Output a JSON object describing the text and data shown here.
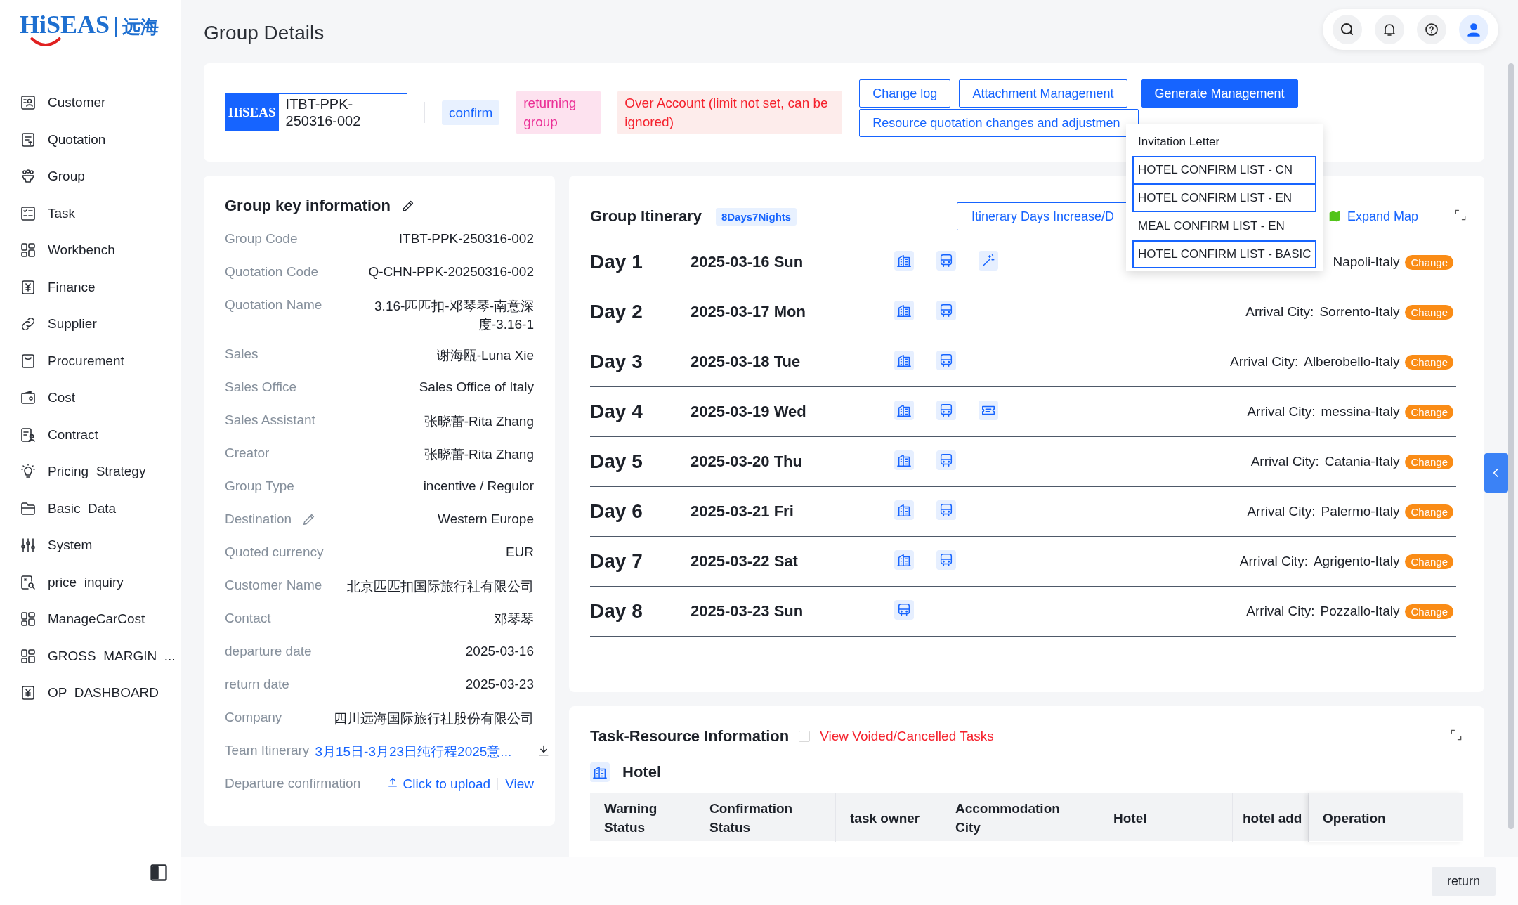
{
  "brand": {
    "logo": "HiSEAS",
    "logo_cn": "远海"
  },
  "sidebar": {
    "items": [
      {
        "label": "Customer"
      },
      {
        "label": "Quotation"
      },
      {
        "label": "Group"
      },
      {
        "label": "Task"
      },
      {
        "label": "Workbench"
      },
      {
        "label": "Finance"
      },
      {
        "label": "Supplier"
      },
      {
        "label": "Procurement"
      },
      {
        "label": "Cost"
      },
      {
        "label": "Contract"
      },
      {
        "label": "Pricing  Strategy"
      },
      {
        "label": "Basic  Data"
      },
      {
        "label": "System"
      },
      {
        "label": "price  inquiry"
      },
      {
        "label": "ManageCarCost"
      },
      {
        "label": "GROSS  MARGIN  ..."
      },
      {
        "label": "OP  DASHBOARD"
      }
    ]
  },
  "page_title": "Group Details",
  "group_header": {
    "badge": "HiSEAS",
    "code": "ITBT-PPK-250316-002",
    "tags": [
      {
        "kind": "info",
        "label": "confirm"
      },
      {
        "kind": "pink",
        "label": "returning group"
      },
      {
        "kind": "warning",
        "label": "Over Account (limit not set, can be ignored)"
      }
    ],
    "actions": [
      {
        "kind": "outline",
        "label": "Change log"
      },
      {
        "kind": "outline",
        "label": "Attachment Management"
      },
      {
        "kind": "primary",
        "label": "Generate Management"
      },
      {
        "kind": "outline",
        "label": "Resource quotation changes and adjustmen"
      }
    ]
  },
  "generate_menu": {
    "items": [
      {
        "label": "Invitation Letter",
        "outlined": false
      },
      {
        "label": "HOTEL CONFIRM LIST - CN",
        "outlined": true
      },
      {
        "label": "HOTEL CONFIRM LIST - EN",
        "outlined": true
      },
      {
        "label": "MEAL CONFIRM LIST - EN",
        "outlined": false
      },
      {
        "label": "HOTEL CONFIRM LIST - BASIC",
        "outlined": true
      }
    ]
  },
  "key_info": {
    "title": "Group key information",
    "rows": [
      {
        "kind": "text",
        "label": "Group Code",
        "value": "ITBT-PPK-250316-002"
      },
      {
        "kind": "text",
        "label": "Quotation Code",
        "value": "Q-CHN-PPK-20250316-002"
      },
      {
        "kind": "text",
        "label": "Quotation Name",
        "value": "3.16-匹匹扣-邓琴琴-南意深度-3.16-1"
      },
      {
        "kind": "text",
        "label": "Sales",
        "value": "谢海瓯-Luna Xie"
      },
      {
        "kind": "text",
        "label": "Sales Office",
        "value": "Sales Office of Italy"
      },
      {
        "kind": "text",
        "label": "Sales Assistant",
        "value": "张晓蕾-Rita Zhang"
      },
      {
        "kind": "text",
        "label": "Creator",
        "value": "张晓蕾-Rita Zhang"
      },
      {
        "kind": "text",
        "label": "Group Type",
        "value": "incentive / Regulor"
      },
      {
        "kind": "editable",
        "label": "Destination",
        "value": "Western Europe"
      },
      {
        "kind": "text",
        "label": "Quoted currency",
        "value": "EUR"
      },
      {
        "kind": "text",
        "label": "Customer Name",
        "value": "北京匹匹扣国际旅行社有限公司"
      },
      {
        "kind": "text",
        "label": "Contact",
        "value": "邓琴琴"
      },
      {
        "kind": "text",
        "label": "departure date",
        "value": "2025-03-16"
      },
      {
        "kind": "text",
        "label": "return date",
        "value": "2025-03-23"
      },
      {
        "kind": "text",
        "label": "Company",
        "value": "四川远海国际旅行社股份有限公司"
      },
      {
        "kind": "download",
        "label": "Team Itinerary",
        "value": "3月15日-3月23日纯行程2025意..."
      },
      {
        "kind": "upload",
        "label": "Departure confirmation",
        "value": "Click to upload",
        "extra": "View"
      }
    ]
  },
  "itinerary": {
    "title": "Group Itinerary",
    "badge": "8Days7Nights",
    "increase_button": "Itinerary Days Increase/D",
    "expand_map": "Expand Map",
    "days": [
      {
        "day": "Day 1",
        "date": "2025-03-16 Sun",
        "services": [
          {
            "kind": "hotel"
          },
          {
            "kind": "bus"
          },
          {
            "kind": "magic"
          }
        ],
        "city": "Napoli-Italy",
        "change": "Change"
      },
      {
        "day": "Day 2",
        "date": "2025-03-17 Mon",
        "services": [
          {
            "kind": "hotel"
          },
          {
            "kind": "bus"
          }
        ],
        "arrival_label": "Arrival City:",
        "city": "Sorrento-Italy",
        "change": "Change"
      },
      {
        "day": "Day 3",
        "date": "2025-03-18 Tue",
        "services": [
          {
            "kind": "hotel"
          },
          {
            "kind": "bus"
          }
        ],
        "arrival_label": "Arrival City:",
        "city": "Alberobello-Italy",
        "change": "Change"
      },
      {
        "day": "Day 4",
        "date": "2025-03-19 Wed",
        "services": [
          {
            "kind": "hotel"
          },
          {
            "kind": "bus"
          },
          {
            "kind": "ticket"
          }
        ],
        "arrival_label": "Arrival City:",
        "city": "messina-Italy",
        "change": "Change"
      },
      {
        "day": "Day 5",
        "date": "2025-03-20 Thu",
        "services": [
          {
            "kind": "hotel"
          },
          {
            "kind": "bus"
          }
        ],
        "arrival_label": "Arrival City:",
        "city": "Catania-Italy",
        "change": "Change"
      },
      {
        "day": "Day 6",
        "date": "2025-03-21 Fri",
        "services": [
          {
            "kind": "hotel"
          },
          {
            "kind": "bus"
          }
        ],
        "arrival_label": "Arrival City:",
        "city": "Palermo-Italy",
        "change": "Change"
      },
      {
        "day": "Day 7",
        "date": "2025-03-22 Sat",
        "services": [
          {
            "kind": "hotel"
          },
          {
            "kind": "bus"
          }
        ],
        "arrival_label": "Arrival City:",
        "city": "Agrigento-Italy",
        "change": "Change"
      },
      {
        "day": "Day 8",
        "date": "2025-03-23 Sun",
        "services": [
          {
            "kind": "bus"
          }
        ],
        "arrival_label": "Arrival City:",
        "city": "Pozzallo-Italy",
        "change": "Change"
      }
    ]
  },
  "task_resource": {
    "title": "Task-Resource Information",
    "voided": {
      "label": "View Voided/Cancelled Tasks",
      "checked": false
    },
    "section": "Hotel",
    "columns": [
      "Warning Status",
      "Confirmation Status",
      "task owner",
      "Accommodation City",
      "Hotel",
      "hotel add",
      "Operation"
    ]
  },
  "footer": {
    "return_button": "return"
  }
}
